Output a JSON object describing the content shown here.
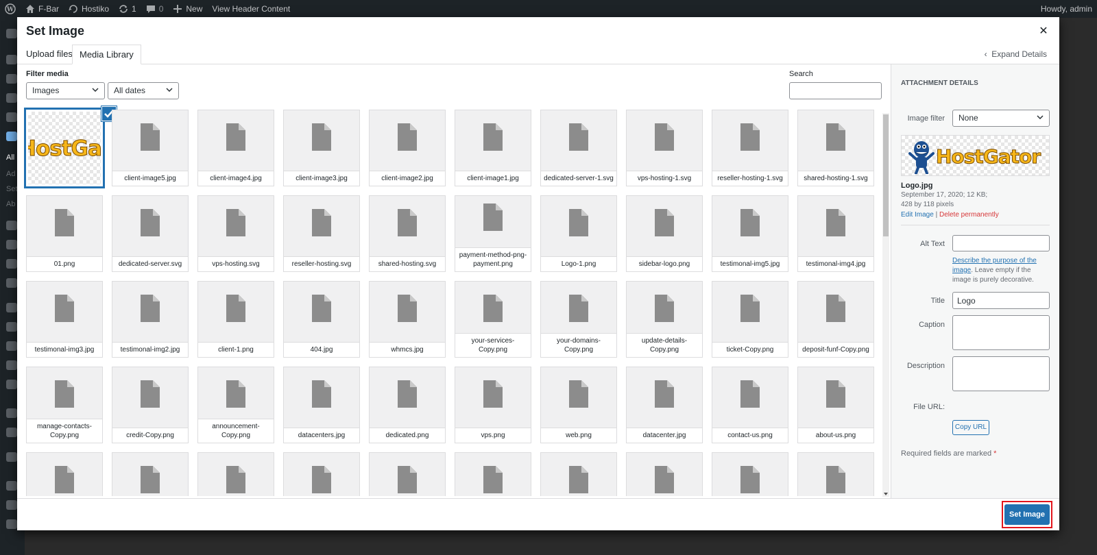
{
  "admin_bar": {
    "items": [
      "F-Bar",
      "Hostiko",
      "1",
      "0",
      "New",
      "View Header Content"
    ],
    "greeting": "Howdy, admin"
  },
  "side_menu_fragments": [
    "All",
    "Ad",
    "Set",
    "Ab"
  ],
  "modal": {
    "title": "Set Image",
    "tabs": [
      {
        "label": "Upload files",
        "active": false
      },
      {
        "label": "Media Library",
        "active": true
      }
    ],
    "expand_details": "Expand Details",
    "toolbar": {
      "filter_label": "Filter media",
      "type_filter": "Images",
      "date_filter": "All dates",
      "search_label": "Search",
      "search_value": ""
    },
    "attachments": [
      [
        "",
        "client-image5.jpg",
        "client-image4.jpg",
        "client-image3.jpg",
        "client-image2.jpg",
        "client-image1.jpg",
        "dedicated-server-1.svg",
        "vps-hosting-1.svg",
        "reseller-hosting-1.svg",
        "shared-hosting-1.svg"
      ],
      [
        "01.png",
        "dedicated-server.svg",
        "vps-hosting.svg",
        "reseller-hosting.svg",
        "shared-hosting.svg",
        "payment-method-png-payment.png",
        "Logo-1.png",
        "sidebar-logo.png",
        "testimonal-img5.jpg",
        "testimonal-img4.jpg"
      ],
      [
        "testimonal-img3.jpg",
        "testimonal-img2.jpg",
        "client-1.png",
        "404.jpg",
        "whmcs.jpg",
        "your-services-Copy.png",
        "your-domains-Copy.png",
        "update-details-Copy.png",
        "ticket-Copy.png",
        "deposit-funf-Copy.png"
      ],
      [
        "manage-contacts-Copy.png",
        "credit-Copy.png",
        "announcement-Copy.png",
        "datacenters.jpg",
        "dedicated.png",
        "vps.png",
        "web.png",
        "datacenter.jpg",
        "contact-us.png",
        "about-us.png"
      ],
      [
        "",
        "",
        "",
        "",
        "",
        "",
        "",
        "",
        "",
        ""
      ]
    ],
    "selected_thumb_text": "HostGa",
    "details": {
      "heading": "ATTACHMENT DETAILS",
      "image_filter_label": "Image filter",
      "image_filter_value": "None",
      "preview_text": "HostGator",
      "filename": "Logo.jpg",
      "date_size": "September 17, 2020; 12 KB;",
      "dimensions": "428 by 118 pixels",
      "edit_link": "Edit Image",
      "separator": "|",
      "delete_link": "Delete permanently",
      "alt_text_label": "Alt Text",
      "alt_text_value": "",
      "alt_help_link": "Describe the purpose of the image",
      "alt_help_text": ". Leave empty if the image is purely decorative.",
      "title_label": "Title",
      "title_value": "Logo",
      "caption_label": "Caption",
      "caption_value": "",
      "description_label": "Description",
      "description_value": "",
      "file_url_label": "File URL:",
      "copy_url_button": "Copy URL",
      "required_note": "Required fields are marked",
      "required_mark": "*"
    },
    "set_image_button": "Set Image"
  }
}
